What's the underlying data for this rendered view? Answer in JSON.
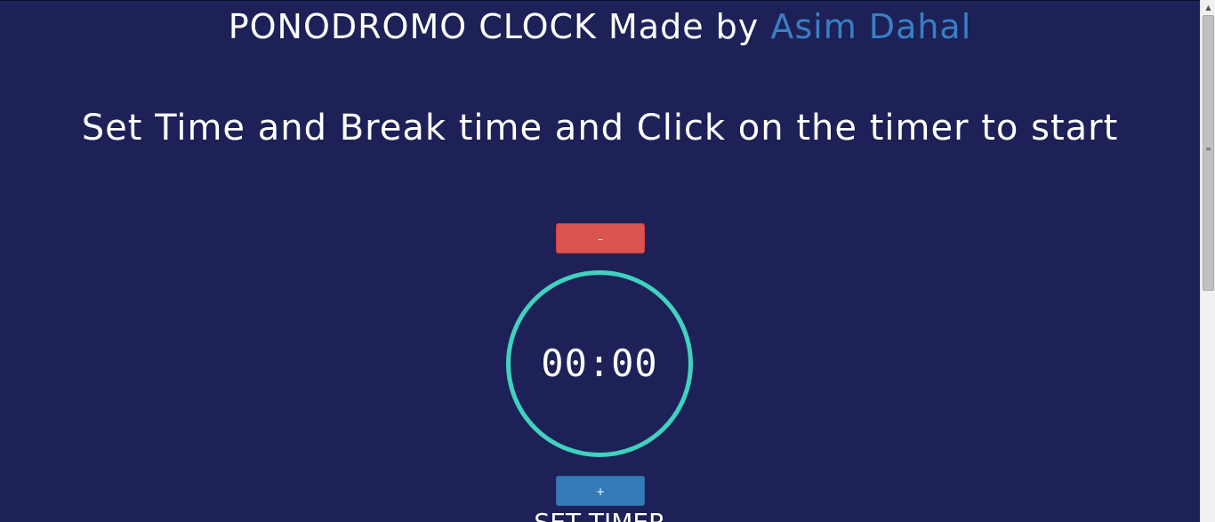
{
  "header": {
    "title_prefix": "PONODROMO CLOCK Made by ",
    "author": "Asim Dahal",
    "instruction": "Set Time and Break time and Click on the timer to start"
  },
  "timer": {
    "decrement_label": "–",
    "display": "00:00",
    "increment_label": "+",
    "set_label": "SET TIMER"
  },
  "colors": {
    "background": "#1d2157",
    "accent_link": "#3a7fc4",
    "circle_border": "#3fd2bf",
    "decrement_button": "#d9534f",
    "increment_button": "#337ab7"
  },
  "scrollbar": {
    "up_icon": "chevron-up-icon",
    "grip_icon": "grip-lines-icon"
  }
}
